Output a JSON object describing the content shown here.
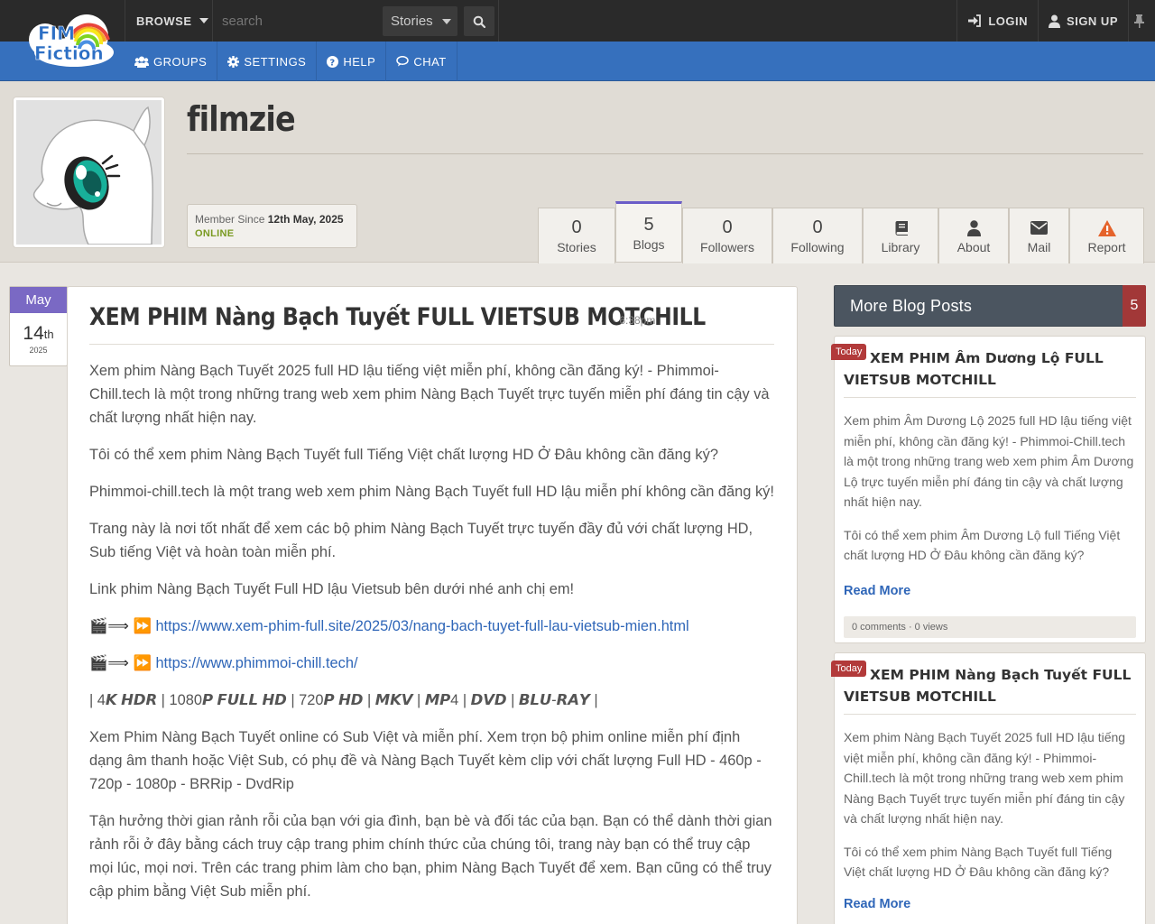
{
  "topbar": {
    "logo_text_top": "FIM",
    "logo_text_bottom": "Fiction",
    "browse_label": "BROWSE",
    "search_placeholder": "search",
    "search_type": "Stories",
    "login_label": "LOGIN",
    "signup_label": "SIGN UP"
  },
  "subnav": {
    "items": [
      {
        "label": "GROUPS",
        "icon": "users-icon"
      },
      {
        "label": "SETTINGS",
        "icon": "gear-icon"
      },
      {
        "label": "HELP",
        "icon": "question-icon"
      },
      {
        "label": "CHAT",
        "icon": "chat-icon"
      }
    ]
  },
  "profile": {
    "username": "filmzie",
    "member_since_label": "Member Since",
    "member_since_date": "12th May, 2025",
    "status": "ONLINE",
    "tabs": [
      {
        "value": "0",
        "label": "Stories"
      },
      {
        "value": "5",
        "label": "Blogs"
      },
      {
        "value": "0",
        "label": "Followers"
      },
      {
        "value": "0",
        "label": "Following"
      },
      {
        "label": "Library",
        "icon": "book-icon"
      },
      {
        "label": "About",
        "icon": "user-icon"
      },
      {
        "label": "Mail",
        "icon": "mail-icon"
      },
      {
        "label": "Report",
        "icon": "warning-icon"
      }
    ]
  },
  "post": {
    "date_month": "May",
    "date_day": "14",
    "date_suffix": "th",
    "date_year": "2025",
    "title": "XEM PHIM Nàng Bạch Tuyết FULL VIETSUB MOTCHILL",
    "time": "· 6:38pm",
    "paragraphs": [
      "Xem phim Nàng Bạch Tuyết 2025 full HD lậu tiếng việt miễn phí, không cần đăng ký! - Phimmoi-Chill.tech là một trong những trang web xem phim Nàng Bạch Tuyết trực tuyến miễn phí đáng tin cậy và chất lượng nhất hiện nay.",
      "Tôi có thể xem phim Nàng Bạch Tuyết full Tiếng Việt chất lượng HD Ở Đâu không cần đăng ký?",
      "Phimmoi-chill.tech là một trang web xem phim Nàng Bạch Tuyết full HD lậu miễn phí không cần đăng ký!",
      "Trang này là nơi tốt nhất để xem các bộ phim Nàng Bạch Tuyết trực tuyến đầy đủ với chất lượng HD, Sub tiếng Việt và hoàn toàn miễn phí.",
      "Link phim Nàng Bạch Tuyết Full HD lậu Vietsub bên dưới nhé anh chị em!"
    ],
    "link1_prefix": "🎬⟹ ⏩",
    "link1": "https://www.xem-phim-full.site/2025/03/nang-bach-tuyet-full-lau-vietsub-mien.html",
    "link2_prefix": "🎬⟹ ⏩",
    "link2": "https://www.phimmoi-chill.tech/",
    "quality_line": "| 4𝙆 𝙃𝘿𝙍 | 1080𝙋 𝙁𝙐𝙇𝙇 𝙃𝘿 | 720𝙋 𝙃𝘿 | 𝙈𝙆𝙑 | 𝙈𝙋4 | 𝘿𝙑𝘿 | 𝘽𝙇𝙐-𝙍𝘼𝙔 |",
    "paragraphs2": [
      "Xem Phim Nàng Bạch Tuyết online có Sub Việt và miễn phí. Xem trọn bộ phim online miễn phí định dạng âm thanh hoặc Việt Sub, có phụ đề và Nàng Bạch Tuyết kèm clip với chất lượng Full HD - 460p - 720p - 1080p - BRRip - DvdRip",
      "Tận hưởng thời gian rảnh rỗi của bạn với gia đình, bạn bè và đối tác của bạn. Bạn có thể dành thời gian rảnh rỗi ở đây bằng cách truy cập trang phim chính thức của chúng tôi, trang này bạn có thể truy cập mọi lúc, mọi nơi. Trên các trang phim làm cho bạn, phim Nàng Bạch Tuyết để xem. Bạn cũng có thể truy cập phim bằng Việt Sub miễn phí."
    ]
  },
  "sidebar": {
    "title": "More Blog Posts",
    "count": "5",
    "cards": [
      {
        "badge": "Today",
        "title": "XEM PHIM Âm Dương Lộ FULL VIETSUB MOTCHILL",
        "p1": "Xem phim Âm Dương Lộ 2025 full HD lậu tiếng việt miễn phí, không cần đăng ký! - Phimmoi-Chill.tech là một trong những trang web xem phim Âm Dương Lộ trực tuyến miễn phí đáng tin cậy và chất lượng nhất hiện nay.",
        "p2": "Tôi có thể xem phim Âm Dương Lộ full Tiếng Việt chất lượng HD Ở Đâu không cần đăng ký?",
        "read_more": "Read More",
        "footer": "0 comments · 0 views"
      },
      {
        "badge": "Today",
        "title": "XEM PHIM Nàng Bạch Tuyết FULL VIETSUB MOTCHILL",
        "p1": "Xem phim Nàng Bạch Tuyết 2025 full HD lậu tiếng việt miễn phí, không cần đăng ký! - Phimmoi-Chill.tech là một trong những trang web xem phim Nàng Bạch Tuyết trực tuyến miễn phí đáng tin cậy và chất lượng nhất hiện nay.",
        "p2": "Tôi có thể xem phim Nàng Bạch Tuyết full Tiếng Việt chất lượng HD Ở Đâu không cần đăng ký?",
        "read_more": "Read More"
      }
    ]
  },
  "colors": {
    "topbar": "#2a2a2a",
    "subnav": "#3670bd",
    "accent_purple": "#7a69c4",
    "badge_red": "#b23a3a",
    "link": "#2f66b8"
  }
}
